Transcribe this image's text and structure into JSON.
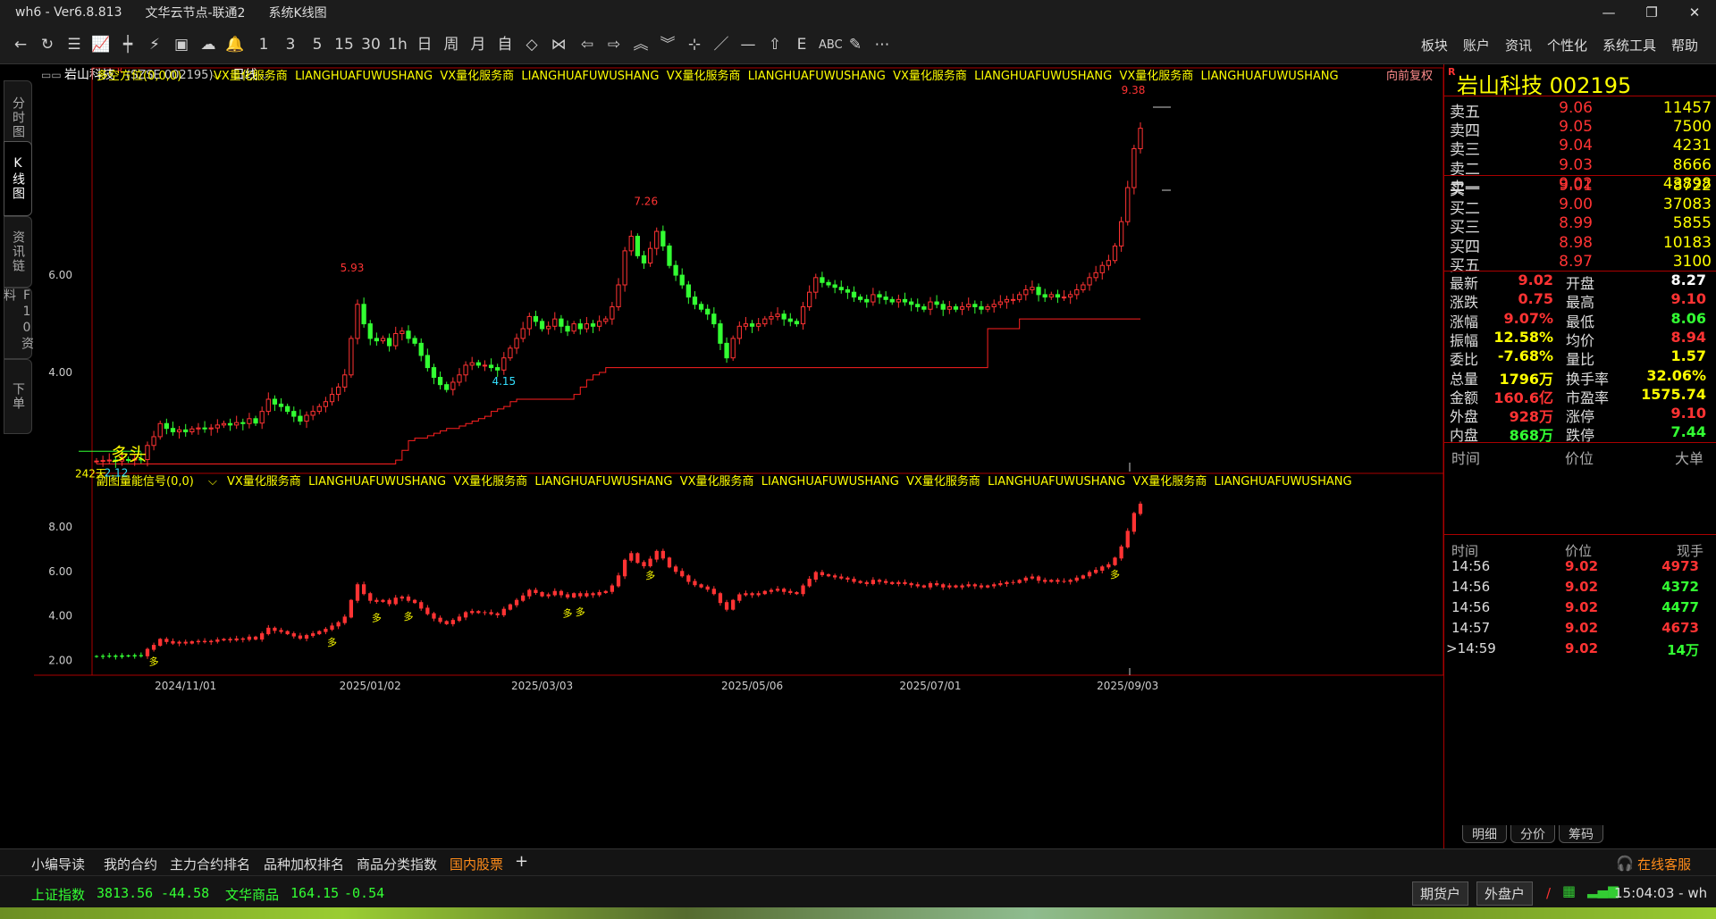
{
  "titlebar": {
    "app": "wh6 - Ver6.8.813",
    "server": "文华云节点-联通2",
    "view": "系统K线图"
  },
  "window_controls": {
    "min": "—",
    "max": "❐",
    "close": "✕"
  },
  "toolbar": {
    "items": [
      {
        "name": "back-icon",
        "text": "←"
      },
      {
        "name": "refresh-icon",
        "text": "↻"
      },
      {
        "name": "list-icon",
        "text": "☰"
      },
      {
        "name": "line-chart-icon",
        "text": "📈"
      },
      {
        "name": "candle-icon",
        "text": "┿"
      },
      {
        "name": "tick-icon",
        "text": "⚡"
      },
      {
        "name": "f10-icon",
        "text": "▣"
      },
      {
        "name": "cloud-icon",
        "text": "☁"
      },
      {
        "name": "bell-icon",
        "text": "🔔"
      },
      {
        "name": "period-1",
        "text": "1"
      },
      {
        "name": "period-3",
        "text": "3"
      },
      {
        "name": "period-5",
        "text": "5"
      },
      {
        "name": "period-15",
        "text": "15"
      },
      {
        "name": "period-30",
        "text": "30"
      },
      {
        "name": "period-1h",
        "text": "1h"
      },
      {
        "name": "period-day",
        "text": "日"
      },
      {
        "name": "period-week",
        "text": "周"
      },
      {
        "name": "period-month",
        "text": "月"
      },
      {
        "name": "period-custom",
        "text": "自"
      },
      {
        "name": "zoom-in-icon",
        "text": "◇"
      },
      {
        "name": "zoom-out-icon",
        "text": "⋈"
      },
      {
        "name": "left-icon",
        "text": "⇦"
      },
      {
        "name": "right-icon",
        "text": "⇨"
      },
      {
        "name": "up-icon",
        "text": "︽"
      },
      {
        "name": "down-icon",
        "text": "︾"
      },
      {
        "name": "crosshair-icon",
        "text": "⊹"
      },
      {
        "name": "draw-line-icon",
        "text": "／"
      },
      {
        "name": "hline-icon",
        "text": "—"
      },
      {
        "name": "home-icon",
        "text": "⇧"
      },
      {
        "name": "text-icon",
        "text": "E"
      },
      {
        "name": "abc-icon",
        "text": "ABC"
      },
      {
        "name": "pen-icon",
        "text": "✎"
      },
      {
        "name": "more-icon",
        "text": "⋯"
      }
    ]
  },
  "menu": [
    "板块",
    "账户",
    "资讯",
    "个性化",
    "系统工具",
    "帮助"
  ],
  "left_tabs": [
    "分时图",
    "K线图",
    "资讯链",
    "F10资料",
    "下单"
  ],
  "chart_header": {
    "symbol": "岩山科技",
    "r_mark": "R",
    "code": "(SZSE 002195)",
    "period": "日线"
  },
  "main_indicator": {
    "name": "多空方位(0,0,0)",
    "tags": "VX量化服务商  LIANGHUAFUWUSHANG  VX量化服务商  LIANGHUAFUWUSHANG  VX量化服务商  LIANGHUAFUWUSHANG  VX量化服务商  LIANGHUAFUWUSHANG  VX量化服务商  LIANGHUAFUWUSHANG",
    "adjust": "向前复权"
  },
  "sub_indicator": {
    "name": "副图量能信号(0,0)",
    "tags": "VX量化服务商  LIANGHUAFUWUSHANG  VX量化服务商  LIANGHUAFUWUSHANG  VX量化服务商  LIANGHUAFUWUSHANG  VX量化服务商  LIANGHUAFUWUSHANG  VX量化服务商  LIANGHUAFUWUSHANG"
  },
  "main_annotations": {
    "high": "9.38",
    "peak1": "5.93",
    "peak2": "7.26",
    "low1": "4.15",
    "low0": "2.12",
    "days": "242天",
    "signal": "多头",
    "buy_mark": "多"
  },
  "chart_data": {
    "type": "candlestick",
    "x_labels": [
      "2024/11/01",
      "2025/01/02",
      "2025/03/03",
      "2025/05/06",
      "2025/07/01",
      "2025/09/03"
    ],
    "main_y_ticks": [
      "6.00",
      "4.00"
    ],
    "main_ylim": [
      2.0,
      9.6
    ],
    "sub_y_ticks": [
      "8.00",
      "6.00",
      "4.00",
      "2.00"
    ],
    "sub_ylim": [
      1.5,
      9.6
    ],
    "close": [
      2.18,
      2.19,
      2.2,
      2.18,
      2.21,
      2.2,
      2.22,
      2.21,
      2.5,
      2.68,
      2.95,
      2.85,
      2.78,
      2.82,
      2.78,
      2.84,
      2.86,
      2.84,
      2.86,
      2.92,
      2.95,
      2.92,
      2.97,
      2.95,
      3.05,
      2.96,
      3.2,
      3.45,
      3.35,
      3.3,
      3.2,
      3.1,
      3.0,
      3.12,
      3.2,
      3.3,
      3.4,
      3.55,
      3.7,
      3.95,
      4.7,
      5.4,
      5.0,
      4.7,
      4.65,
      4.7,
      4.55,
      4.8,
      4.85,
      4.7,
      4.6,
      4.35,
      4.1,
      3.9,
      3.75,
      3.65,
      3.8,
      3.95,
      4.15,
      4.2,
      4.15,
      4.15,
      4.1,
      4.05,
      4.3,
      4.5,
      4.7,
      4.9,
      5.15,
      5.05,
      4.9,
      4.95,
      5.1,
      4.95,
      4.85,
      5.0,
      4.9,
      5.0,
      4.95,
      5.05,
      5.1,
      5.35,
      5.8,
      6.5,
      6.8,
      6.4,
      6.25,
      6.55,
      6.9,
      6.6,
      6.2,
      6.0,
      5.8,
      5.55,
      5.4,
      5.3,
      5.2,
      5.0,
      4.6,
      4.3,
      4.7,
      4.95,
      5.0,
      4.95,
      5.0,
      5.1,
      5.15,
      5.2,
      5.1,
      5.05,
      5.0,
      5.35,
      5.65,
      5.95,
      5.85,
      5.8,
      5.75,
      5.7,
      5.65,
      5.55,
      5.5,
      5.45,
      5.6,
      5.55,
      5.5,
      5.45,
      5.5,
      5.45,
      5.4,
      5.35,
      5.3,
      5.45,
      5.4,
      5.3,
      5.35,
      5.3,
      5.35,
      5.4,
      5.35,
      5.3,
      5.35,
      5.4,
      5.45,
      5.5,
      5.5,
      5.6,
      5.7,
      5.75,
      5.6,
      5.55,
      5.6,
      5.55,
      5.55,
      5.6,
      5.7,
      5.8,
      5.95,
      6.05,
      6.2,
      6.3,
      6.6,
      7.1,
      7.8,
      8.6,
      9.02
    ],
    "baseline": [
      2.12,
      2.12,
      2.12,
      2.12,
      2.12,
      2.12,
      2.12,
      2.12,
      2.12,
      2.12,
      2.12,
      2.12,
      2.12,
      2.12,
      2.12,
      2.12,
      2.12,
      2.12,
      2.12,
      2.12,
      2.12,
      2.12,
      2.12,
      2.12,
      2.12,
      2.12,
      2.12,
      2.12,
      2.12,
      2.12,
      2.12,
      2.12,
      2.12,
      2.12,
      2.12,
      2.12,
      2.12,
      2.12,
      2.12,
      2.12,
      2.12,
      2.12,
      2.12,
      2.12,
      2.12,
      2.12,
      2.12,
      2.2,
      2.4,
      2.6,
      2.65,
      2.65,
      2.7,
      2.75,
      2.8,
      2.85,
      2.85,
      2.9,
      2.95,
      3.0,
      3.05,
      3.1,
      3.2,
      3.25,
      3.3,
      3.4,
      3.45,
      3.45,
      3.45,
      3.45,
      3.45,
      3.45,
      3.45,
      3.45,
      3.45,
      3.55,
      3.7,
      3.85,
      3.95,
      4.0,
      4.1,
      4.1,
      4.1,
      4.1,
      4.1,
      4.1,
      4.1,
      4.1,
      4.1,
      4.1,
      4.1,
      4.1,
      4.1,
      4.1,
      4.1,
      4.1,
      4.1,
      4.1,
      4.1,
      4.1,
      4.1,
      4.1,
      4.1,
      4.1,
      4.1,
      4.1,
      4.1,
      4.1,
      4.1,
      4.1,
      4.1,
      4.1,
      4.1,
      4.1,
      4.1,
      4.1,
      4.1,
      4.1,
      4.1,
      4.1,
      4.1,
      4.1,
      4.1,
      4.1,
      4.1,
      4.1,
      4.1,
      4.1,
      4.1,
      4.1,
      4.1,
      4.1,
      4.1,
      4.1,
      4.1,
      4.1,
      4.1,
      4.1,
      4.1,
      4.1,
      4.9,
      4.9,
      4.9,
      4.9,
      4.9,
      5.1,
      5.1,
      5.1,
      5.1,
      5.1,
      5.1,
      5.1,
      5.1,
      5.1,
      5.1,
      5.1,
      5.1,
      5.1,
      5.1,
      5.1,
      5.1,
      5.1,
      5.1,
      5.1,
      5.1
    ]
  },
  "quote": {
    "title": "岩山科技  002195",
    "r_mark": "R",
    "asks": [
      {
        "l": "卖五",
        "p": "9.06",
        "v": "11457"
      },
      {
        "l": "卖四",
        "p": "9.05",
        "v": "7500"
      },
      {
        "l": "卖三",
        "p": "9.04",
        "v": "4231"
      },
      {
        "l": "卖二",
        "p": "9.03",
        "v": "8666"
      },
      {
        "l": "卖一",
        "p": "9.02",
        "v": "43898"
      }
    ],
    "bids": [
      {
        "l": "买一",
        "p": "9.01",
        "v": "8722"
      },
      {
        "l": "买二",
        "p": "9.00",
        "v": "37083"
      },
      {
        "l": "买三",
        "p": "8.99",
        "v": "5855"
      },
      {
        "l": "买四",
        "p": "8.98",
        "v": "10183"
      },
      {
        "l": "买五",
        "p": "8.97",
        "v": "3100"
      }
    ],
    "stats": [
      {
        "l": "最新",
        "v": "9.02",
        "c": "#ff3333",
        "l2": "开盘",
        "v2": "8.27",
        "c2": "#ffffff"
      },
      {
        "l": "涨跌",
        "v": "0.75",
        "c": "#ff3333",
        "l2": "最高",
        "v2": "9.10",
        "c2": "#ff3333"
      },
      {
        "l": "涨幅",
        "v": "9.07%",
        "c": "#ff3333",
        "l2": "最低",
        "v2": "8.06",
        "c2": "#33ff33"
      },
      {
        "l": "振幅",
        "v": "12.58%",
        "c": "#ffff00",
        "l2": "均价",
        "v2": "8.94",
        "c2": "#ff3333"
      },
      {
        "l": "委比",
        "v": "-7.68%",
        "c": "#ffff00",
        "l2": "量比",
        "v2": "1.57",
        "c2": "#ffff00"
      },
      {
        "l": "总量",
        "v": "1796万",
        "c": "#ffff00",
        "l2": "换手率",
        "v2": "32.06%",
        "c2": "#ffff00"
      },
      {
        "l": "金额",
        "v": "160.6亿",
        "c": "#ff3333",
        "l2": "市盈率",
        "v2": "1575.74",
        "c2": "#ffff00"
      },
      {
        "l": "外盘",
        "v": "928万",
        "c": "#ff3333",
        "l2": "涨停",
        "v2": "9.10",
        "c2": "#ff3333"
      },
      {
        "l": "内盘",
        "v": "868万",
        "c": "#33ff33",
        "l2": "跌停",
        "v2": "7.44",
        "c2": "#33ff33"
      }
    ],
    "big_head": {
      "time": "时间",
      "price": "价位",
      "big": "大单"
    },
    "tick_head": {
      "time": "时间",
      "price": "价位",
      "vol": "现手"
    },
    "ticks": [
      {
        "t": "14:56",
        "p": "9.02",
        "v": "4973",
        "c": "#ff3333"
      },
      {
        "t": "14:56",
        "p": "9.02",
        "v": "4372",
        "c": "#33ff33"
      },
      {
        "t": "14:56",
        "p": "9.02",
        "v": "4477",
        "c": "#33ff33"
      },
      {
        "t": "14:57",
        "p": "9.02",
        "v": "4673",
        "c": "#ff3333"
      },
      {
        "t": ">14:59",
        "p": "9.02",
        "v": "14万",
        "c": "#33ff33"
      }
    ],
    "tabs": [
      "明细",
      "分价",
      "筹码"
    ]
  },
  "bottom_tabs": [
    "小编导读",
    "我的合约",
    "主力合约排名",
    "品种加权排名",
    "商品分类指数",
    "国内股票"
  ],
  "bottom_right": "在线客服",
  "status": {
    "idx1": "上证指数",
    "idx1v": "3813.56",
    "idx1c": "-44.58",
    "idx2": "文华商品",
    "idx2v": "164.15",
    "idx2c": "-0.54",
    "btn1": "期货户",
    "btn2": "外盘户",
    "time": "15:04:03 - wh"
  },
  "colors": {
    "up": "#ff3333",
    "down": "#33ff33",
    "accent": "#ff8c1a",
    "border": "#aa0000",
    "label": "#ffff00"
  }
}
